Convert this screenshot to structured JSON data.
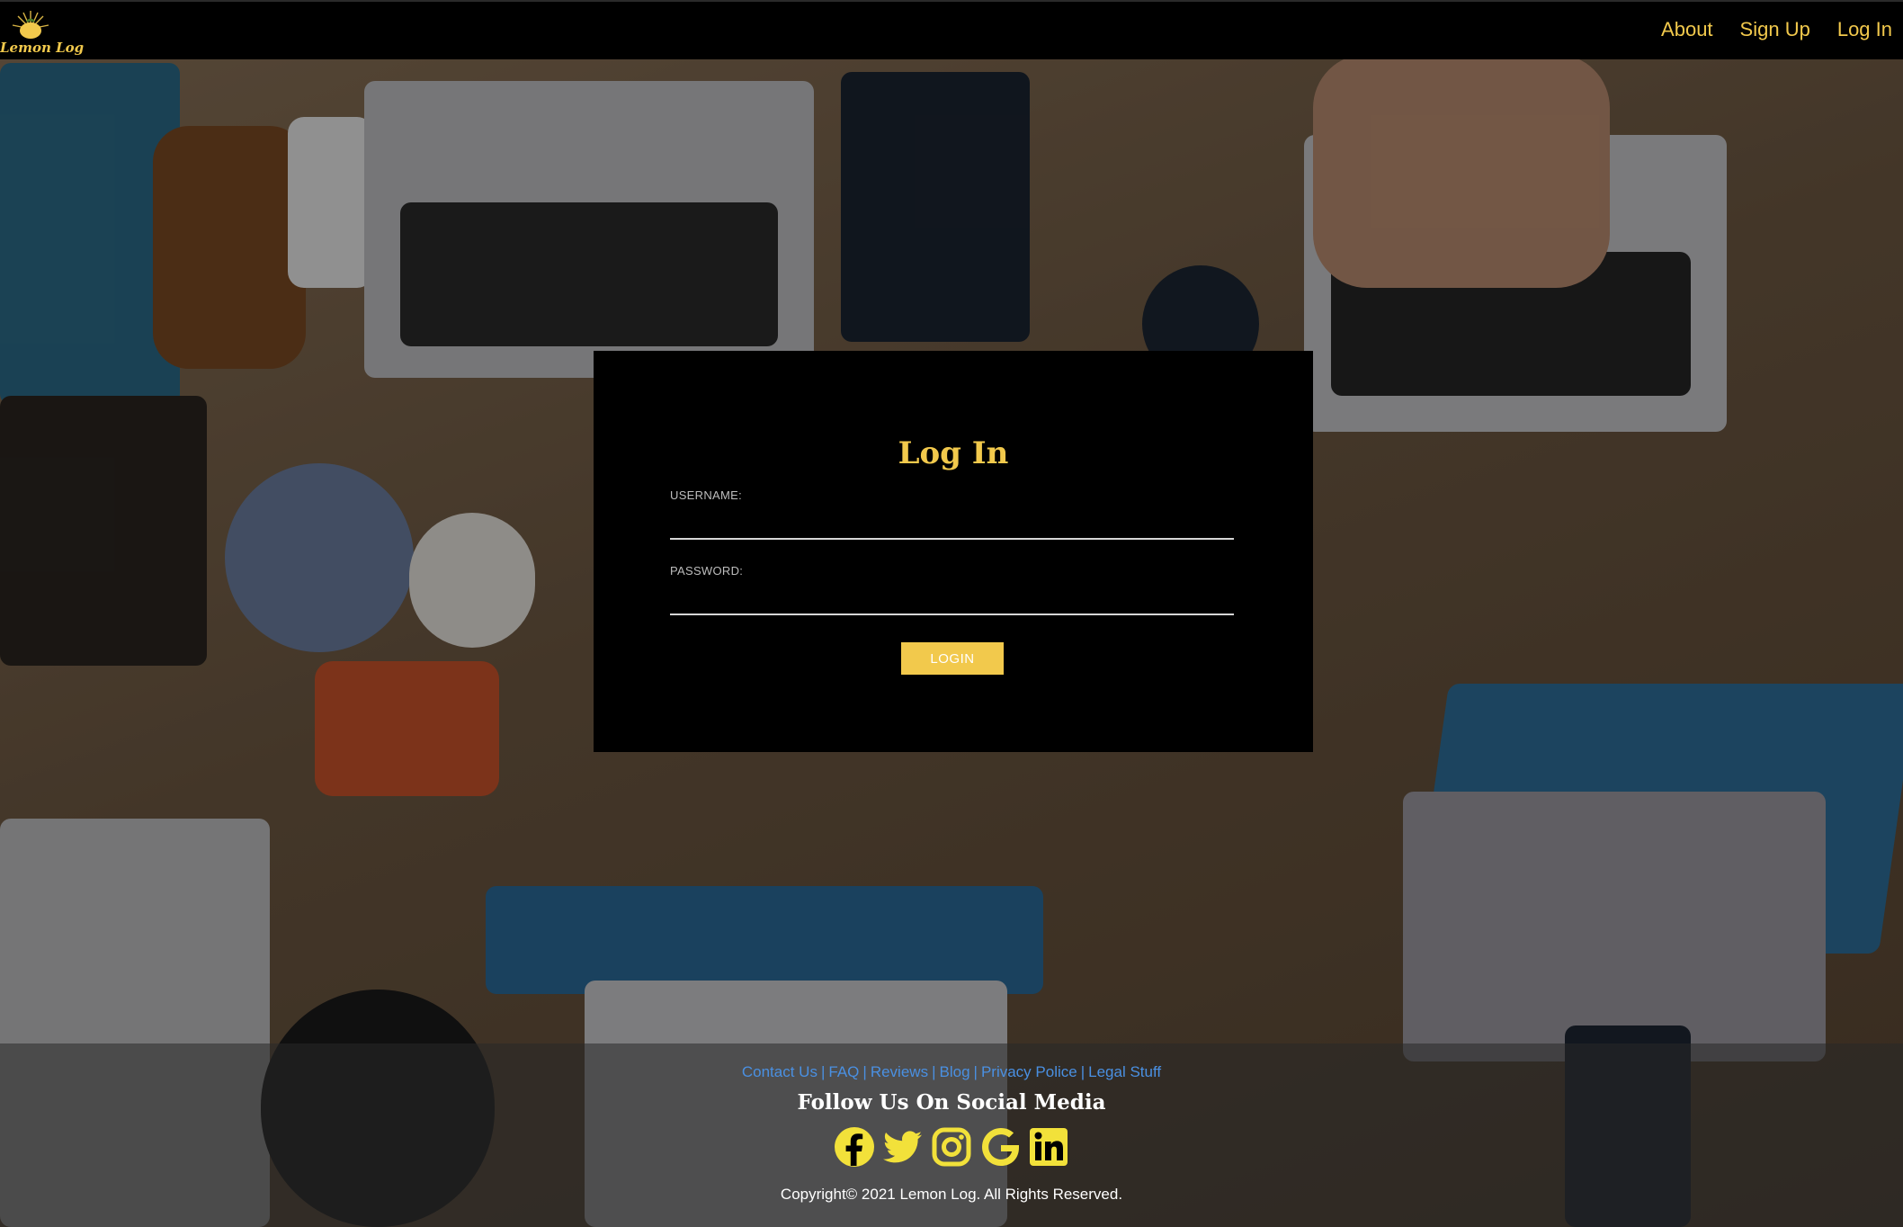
{
  "brand": {
    "name": "Lemon Log",
    "accent": "#f2c94c"
  },
  "nav": {
    "items": [
      "About",
      "Sign Up",
      "Log In"
    ]
  },
  "login": {
    "title": "Log In",
    "username_label": "USERNAME:",
    "password_label": "PASSWORD:",
    "username_value": "",
    "password_value": "",
    "button_label": "LOGIN"
  },
  "footer": {
    "links": [
      "Contact Us",
      "FAQ",
      "Reviews",
      "Blog",
      "Privacy Police",
      "Legal Stuff"
    ],
    "link_separator": "|",
    "follow_title": "Follow Us On Social Media",
    "social_icons": [
      "facebook-icon",
      "twitter-icon",
      "instagram-icon",
      "google-icon",
      "linkedin-icon"
    ],
    "copyright": "Copyright© 2021 Lemon Log. All Rights Reserved."
  },
  "colors": {
    "link": "#4a90e2",
    "nav_bg": "#000000",
    "card_bg": "#000000"
  }
}
